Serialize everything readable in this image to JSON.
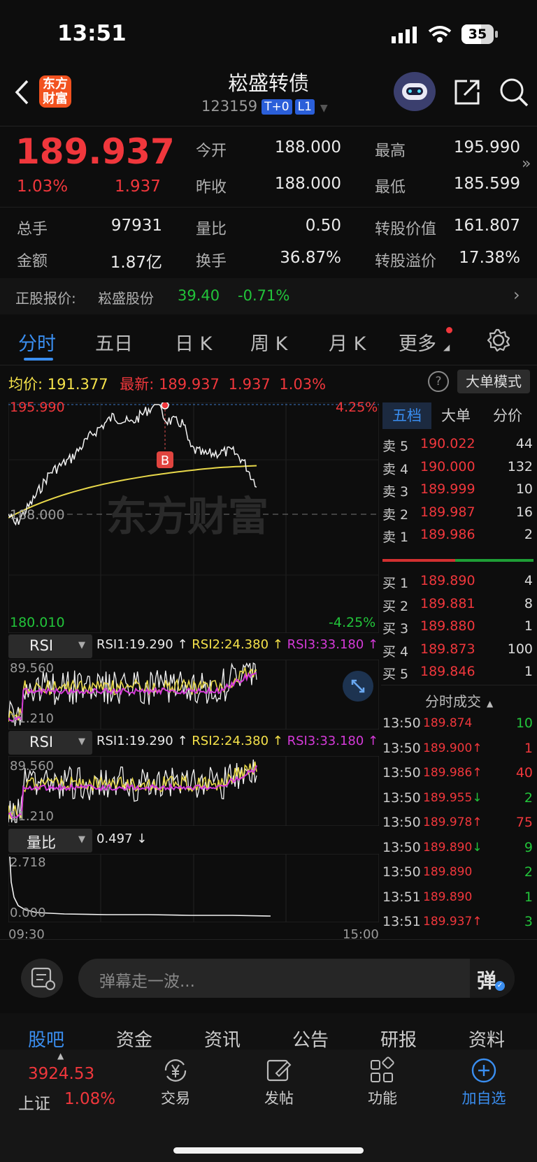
{
  "status_bar": {
    "time": "13:51",
    "battery": "35"
  },
  "header": {
    "title": "崧盛转债",
    "code": "123159",
    "tag1": "T+0",
    "tag2": "L1",
    "logo_text": "东方财富"
  },
  "quote": {
    "price": "189.937",
    "change_pct": "1.03%",
    "change": "1.937",
    "row1": [
      {
        "label": "今开",
        "value": "188.000"
      },
      {
        "label": "最高",
        "value": "195.990"
      }
    ],
    "row2": [
      {
        "label": "昨收",
        "value": "188.000"
      },
      {
        "label": "最低",
        "value": "185.599"
      }
    ],
    "row3": [
      {
        "label": "总手",
        "value": "97931"
      },
      {
        "label": "量比",
        "value": "0.50"
      },
      {
        "label": "转股价值",
        "value": "161.807"
      }
    ],
    "row4": [
      {
        "label": "金额",
        "value": "1.87亿"
      },
      {
        "label": "换手",
        "value": "36.87%"
      },
      {
        "label": "转股溢价",
        "value": "17.38%"
      }
    ]
  },
  "stock_line": {
    "label": "正股报价:",
    "name": "崧盛股份",
    "price": "39.40",
    "change": "-0.71%"
  },
  "tabs": [
    "分时",
    "五日",
    "日 K",
    "周 K",
    "月 K",
    "更多"
  ],
  "chart_info": {
    "avg_label": "均价:",
    "avg_value": "191.377",
    "latest_label": "最新:",
    "latest_value": "189.937",
    "latest_change": "1.937",
    "latest_pct": "1.03%",
    "mode_button": "大单模式",
    "high": "195.990",
    "high_pct": "4.25%",
    "mid": "188.000",
    "low": "180.010",
    "low_pct": "-4.25%",
    "b_marker": "B",
    "watermark": "东方财富"
  },
  "rsi_panels": [
    {
      "name": "RSI",
      "rsi1": "RSI1:19.290 ↑",
      "rsi2": "RSI2:24.380 ↑",
      "rsi3": "RSI3:33.180 ↑",
      "top": "89.560",
      "bottom": "11.210"
    },
    {
      "name": "RSI",
      "rsi1": "RSI1:19.290 ↑",
      "rsi2": "RSI2:24.380 ↑",
      "rsi3": "RSI3:33.180 ↑",
      "top": "89.560",
      "bottom": "11.210"
    }
  ],
  "volume_ratio": {
    "name": "量比",
    "value": "0.497 ↓",
    "top": "2.718",
    "bottom": "0.000"
  },
  "time_axis": {
    "start": "09:30",
    "end": "15:00"
  },
  "book_tabs": [
    "五档",
    "大单",
    "分价"
  ],
  "asks": [
    {
      "label": "卖 5",
      "price": "190.022",
      "vol": "44"
    },
    {
      "label": "卖 4",
      "price": "190.000",
      "vol": "132"
    },
    {
      "label": "卖 3",
      "price": "189.999",
      "vol": "10"
    },
    {
      "label": "卖 2",
      "price": "189.987",
      "vol": "16"
    },
    {
      "label": "卖 1",
      "price": "189.986",
      "vol": "2"
    }
  ],
  "bids": [
    {
      "label": "买 1",
      "price": "189.890",
      "vol": "4"
    },
    {
      "label": "买 2",
      "price": "189.881",
      "vol": "8"
    },
    {
      "label": "买 3",
      "price": "189.880",
      "vol": "1"
    },
    {
      "label": "买 4",
      "price": "189.873",
      "vol": "100"
    },
    {
      "label": "买 5",
      "price": "189.846",
      "vol": "1"
    }
  ],
  "trades_title": "分时成交",
  "trades": [
    {
      "time": "13:50",
      "price": "189.874",
      "arrow": "",
      "vol": "10",
      "vcolor": "green"
    },
    {
      "time": "13:50",
      "price": "189.900",
      "arrow": "↑",
      "vol": "1",
      "vcolor": "red"
    },
    {
      "time": "13:50",
      "price": "189.986",
      "arrow": "↑",
      "vol": "40",
      "vcolor": "red"
    },
    {
      "time": "13:50",
      "price": "189.955",
      "arrow": "↓",
      "vol": "2",
      "vcolor": "green"
    },
    {
      "time": "13:50",
      "price": "189.978",
      "arrow": "↑",
      "vol": "75",
      "vcolor": "red"
    },
    {
      "time": "13:50",
      "price": "189.890",
      "arrow": "↓",
      "vol": "9",
      "vcolor": "green"
    },
    {
      "time": "13:50",
      "price": "189.890",
      "arrow": "",
      "vol": "2",
      "vcolor": "green"
    },
    {
      "time": "13:51",
      "price": "189.890",
      "arrow": "",
      "vol": "1",
      "vcolor": "green"
    },
    {
      "time": "13:51",
      "price": "189.937",
      "arrow": "↑",
      "vol": "3",
      "vcolor": "green"
    }
  ],
  "comment": {
    "placeholder": "弹幕走一波...",
    "button": "弹"
  },
  "bottom_tabs": [
    "股吧",
    "资金",
    "资讯",
    "公告",
    "研报",
    "资料"
  ],
  "index": {
    "value": "3924.53",
    "name": "上证",
    "pct": "1.08%"
  },
  "nav": [
    {
      "label": "交易"
    },
    {
      "label": "发帖"
    },
    {
      "label": "功能"
    },
    {
      "label": "加自选"
    }
  ],
  "colors": {
    "up": "#f0373c",
    "down": "#22c43a",
    "accent": "#3a8ef0",
    "avg_line": "#e8d84a",
    "rsi3": "#d43ad8"
  }
}
